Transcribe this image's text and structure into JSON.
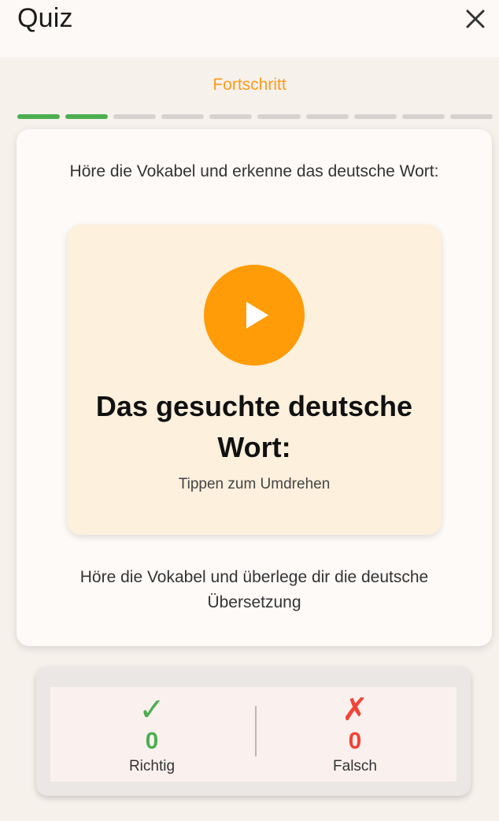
{
  "header": {
    "title": "Quiz",
    "close_icon": "close-icon"
  },
  "progress": {
    "label": "Fortschritt",
    "total_steps": 10,
    "completed_steps": 2,
    "colors": {
      "label": "#ff9b1a",
      "done": "#4caf50",
      "pending": "#d6d2cf"
    }
  },
  "card": {
    "instruction": "Höre die Vokabel und erkenne das deutsche Wort:",
    "flashcard": {
      "play_icon": "play-icon",
      "word": "Das gesuchte deutsche Wort:",
      "flip_hint": "Tippen zum Umdrehen",
      "accent_color": "#ff9c08"
    },
    "hint": "Höre die Vokabel und überlege dir die deutsche Übersetzung"
  },
  "stats": {
    "correct": {
      "icon": "✓",
      "value": "0",
      "label": "Richtig",
      "color": "#4caf50"
    },
    "wrong": {
      "icon": "✗",
      "value": "0",
      "label": "Falsch",
      "color": "#f44336"
    }
  }
}
